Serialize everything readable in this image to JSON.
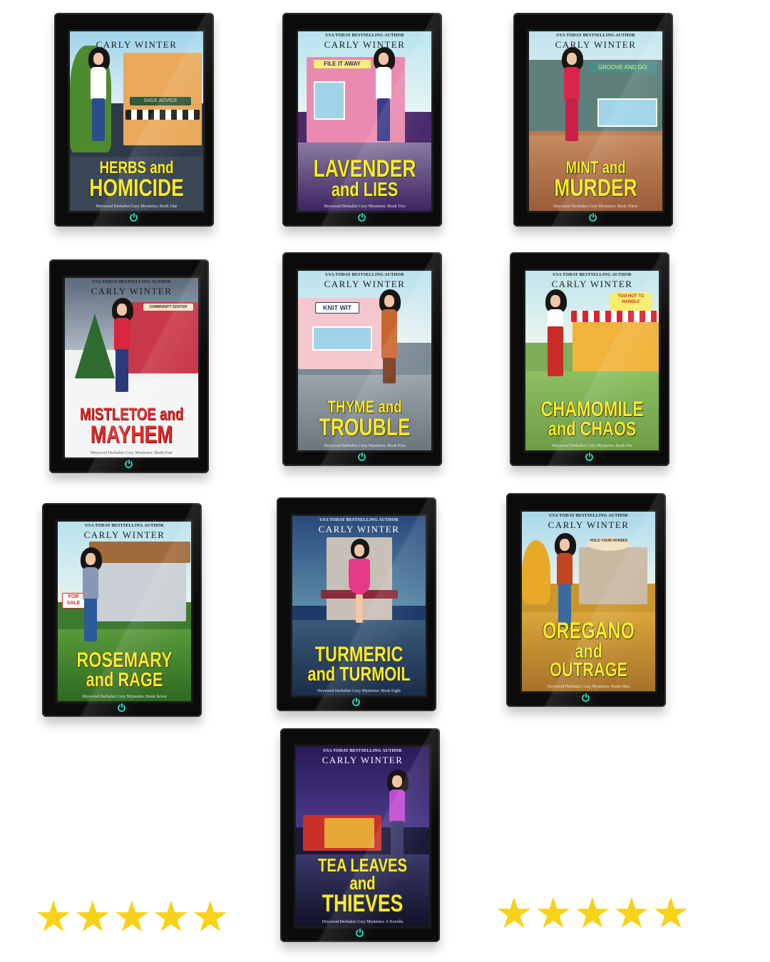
{
  "colors": {
    "star": "#f8d21a",
    "title_yellow": "#f8ea22",
    "power_led": "#1fd0b8"
  },
  "books": [
    {
      "tagline": "",
      "author": "CARLY WINTER",
      "title_l1": "HERBS and",
      "title_l2": "HOMICIDE",
      "series": "Heywood Herbalist Cozy Mysteries: Book One",
      "shop_sign": "SAGE ADVICE"
    },
    {
      "tagline": "USA TODAY BESTSELLING AUTHOR",
      "author": "CARLY WINTER",
      "title_l1": "LAVENDER",
      "title_l2": "and LIES",
      "series": "Heywood Herbalist Cozy Mysteries: Book Two",
      "shop_sign": "FILE IT AWAY"
    },
    {
      "tagline": "USA TODAY BESTSELLING AUTHOR",
      "author": "CARLY WINTER",
      "title_l1": "MINT and",
      "title_l2": "MURDER",
      "series": "Heywood Herbalist Cozy Mysteries: Book Three",
      "shop_sign": "GROOVE AND GO"
    },
    {
      "tagline": "USA TODAY BESTSELLING AUTHOR",
      "author": "CARLY WINTER",
      "title_l1": "MISTLETOE and",
      "title_l2": "MAYHEM",
      "series": "Heywood Herbalist Cozy Mysteries: Book Four",
      "shop_sign": "COMMUNITY CENTER"
    },
    {
      "tagline": "USA TODAY BESTSELLING AUTHOR",
      "author": "CARLY WINTER",
      "title_l1": "THYME and",
      "title_l2": "TROUBLE",
      "series": "Heywood Herbalist Cozy Mysteries: Book Five",
      "shop_sign": "KNIT WIT"
    },
    {
      "tagline": "USA TODAY BESTSELLING AUTHOR",
      "author": "CARLY WINTER",
      "title_l1": "CHAMOMILE",
      "title_l2": "and CHAOS",
      "series": "Heywood Herbalist Cozy Mysteries: Book Six",
      "shop_sign": "TOO HOT TO HANDLE"
    },
    {
      "tagline": "USA TODAY BESTSELLING AUTHOR",
      "author": "CARLY WINTER",
      "title_l1": "ROSEMARY",
      "title_l2": "and RAGE",
      "series": "Heywood Herbalist Cozy Mysteries: Book Seven",
      "shop_sign": "FOR SALE"
    },
    {
      "tagline": "USA TODAY BESTSELLING AUTHOR",
      "author": "CARLY WINTER",
      "title_l1": "TURMERIC",
      "title_l2": "and TURMOIL",
      "series": "Heywood Herbalist Cozy Mysteries: Book Eight",
      "shop_sign": ""
    },
    {
      "tagline": "USA TODAY BESTSELLING AUTHOR",
      "author": "CARLY WINTER",
      "title_l1": "OREGANO",
      "title_l2": "and OUTRAGE",
      "series": "Heywood Herbalist Cozy Mysteries: Book Nine",
      "shop_sign": "HOLD YOUR HORSES"
    },
    {
      "tagline": "USA TODAY BESTSELLING AUTHOR",
      "author": "CARLY WINTER",
      "title_l1": "TEA LEAVES and",
      "title_l2": "THIEVES",
      "series": "Heywood Herbalist Cozy Mysteries: A Novella",
      "shop_sign": ""
    }
  ],
  "ratings": [
    {
      "stars": 5,
      "max": 5,
      "glyph": "★"
    },
    {
      "stars": 5,
      "max": 5,
      "glyph": "★"
    }
  ]
}
